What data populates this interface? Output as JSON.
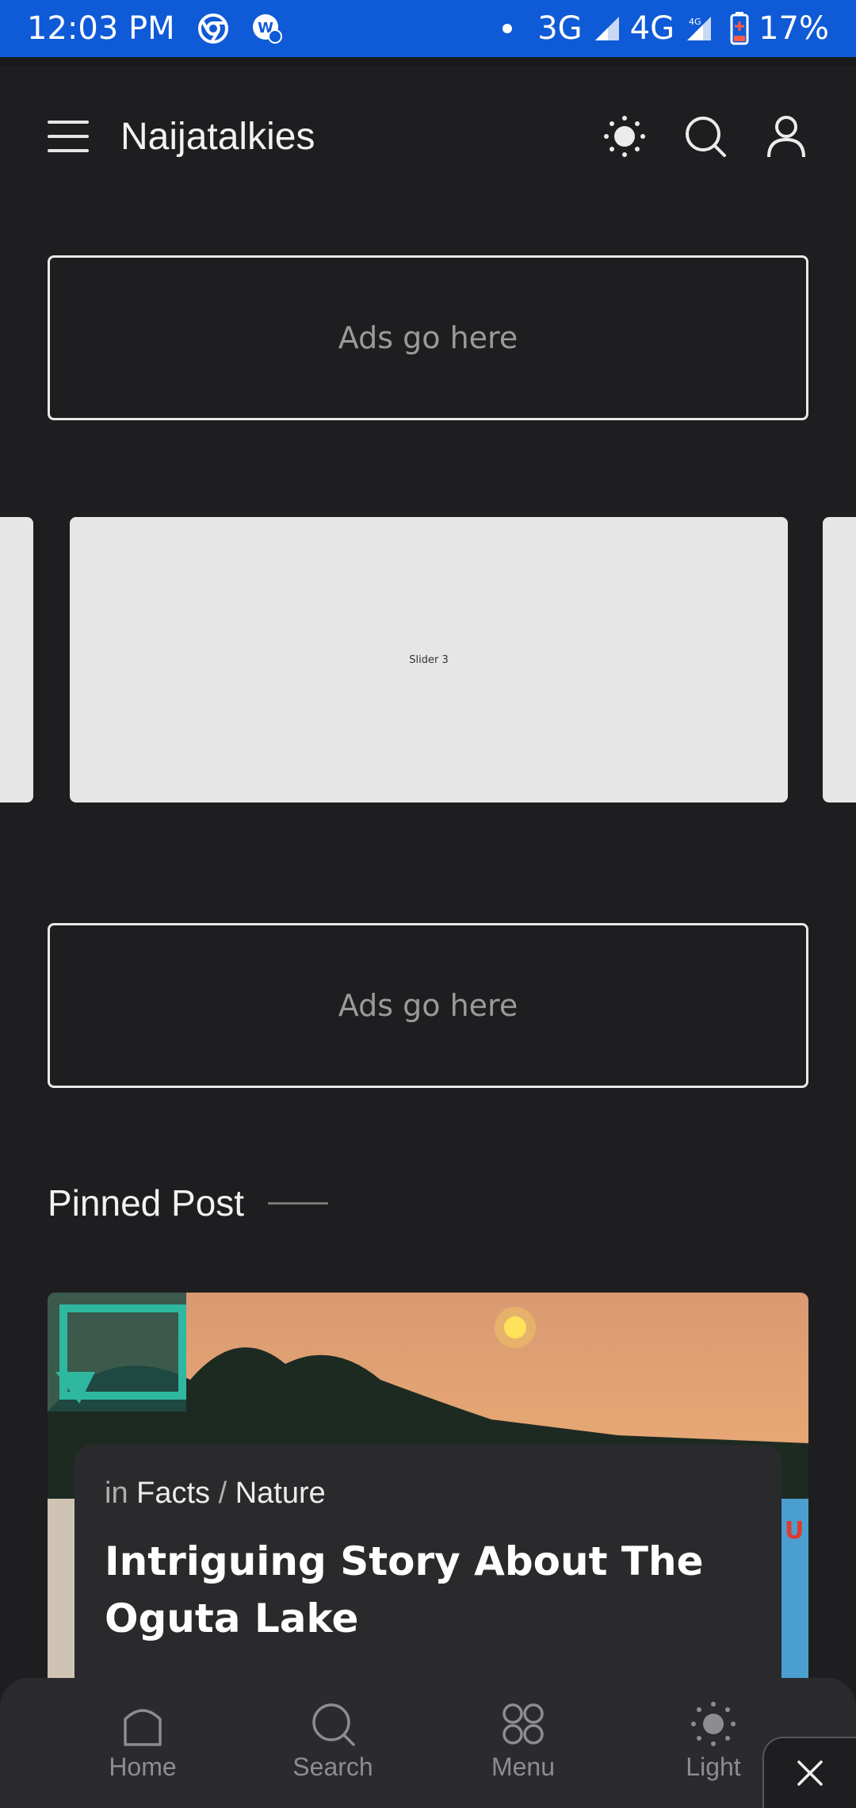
{
  "status_bar": {
    "time": "12:03 PM",
    "net1": "3G",
    "net2": "4G",
    "net2_sup": "4G",
    "battery": "17%"
  },
  "header": {
    "brand": "Naijatalkies"
  },
  "ads": {
    "top": "Ads go here",
    "middle": "Ads go here"
  },
  "slider": {
    "active_label": "Slider 3"
  },
  "section": {
    "pinned_title": "Pinned Post"
  },
  "post": {
    "in_prefix": "in",
    "category_1": "Facts",
    "separator": "/",
    "category_2": "Nature",
    "title": "Intriguing Story About The Oguta Lake"
  },
  "bottom_nav": {
    "home": "Home",
    "search": "Search",
    "menu": "Menu",
    "light": "Light"
  },
  "colors": {
    "status_bar": "#0f5ad6",
    "background": "#1e1e20",
    "card": "#2a2a2d"
  }
}
